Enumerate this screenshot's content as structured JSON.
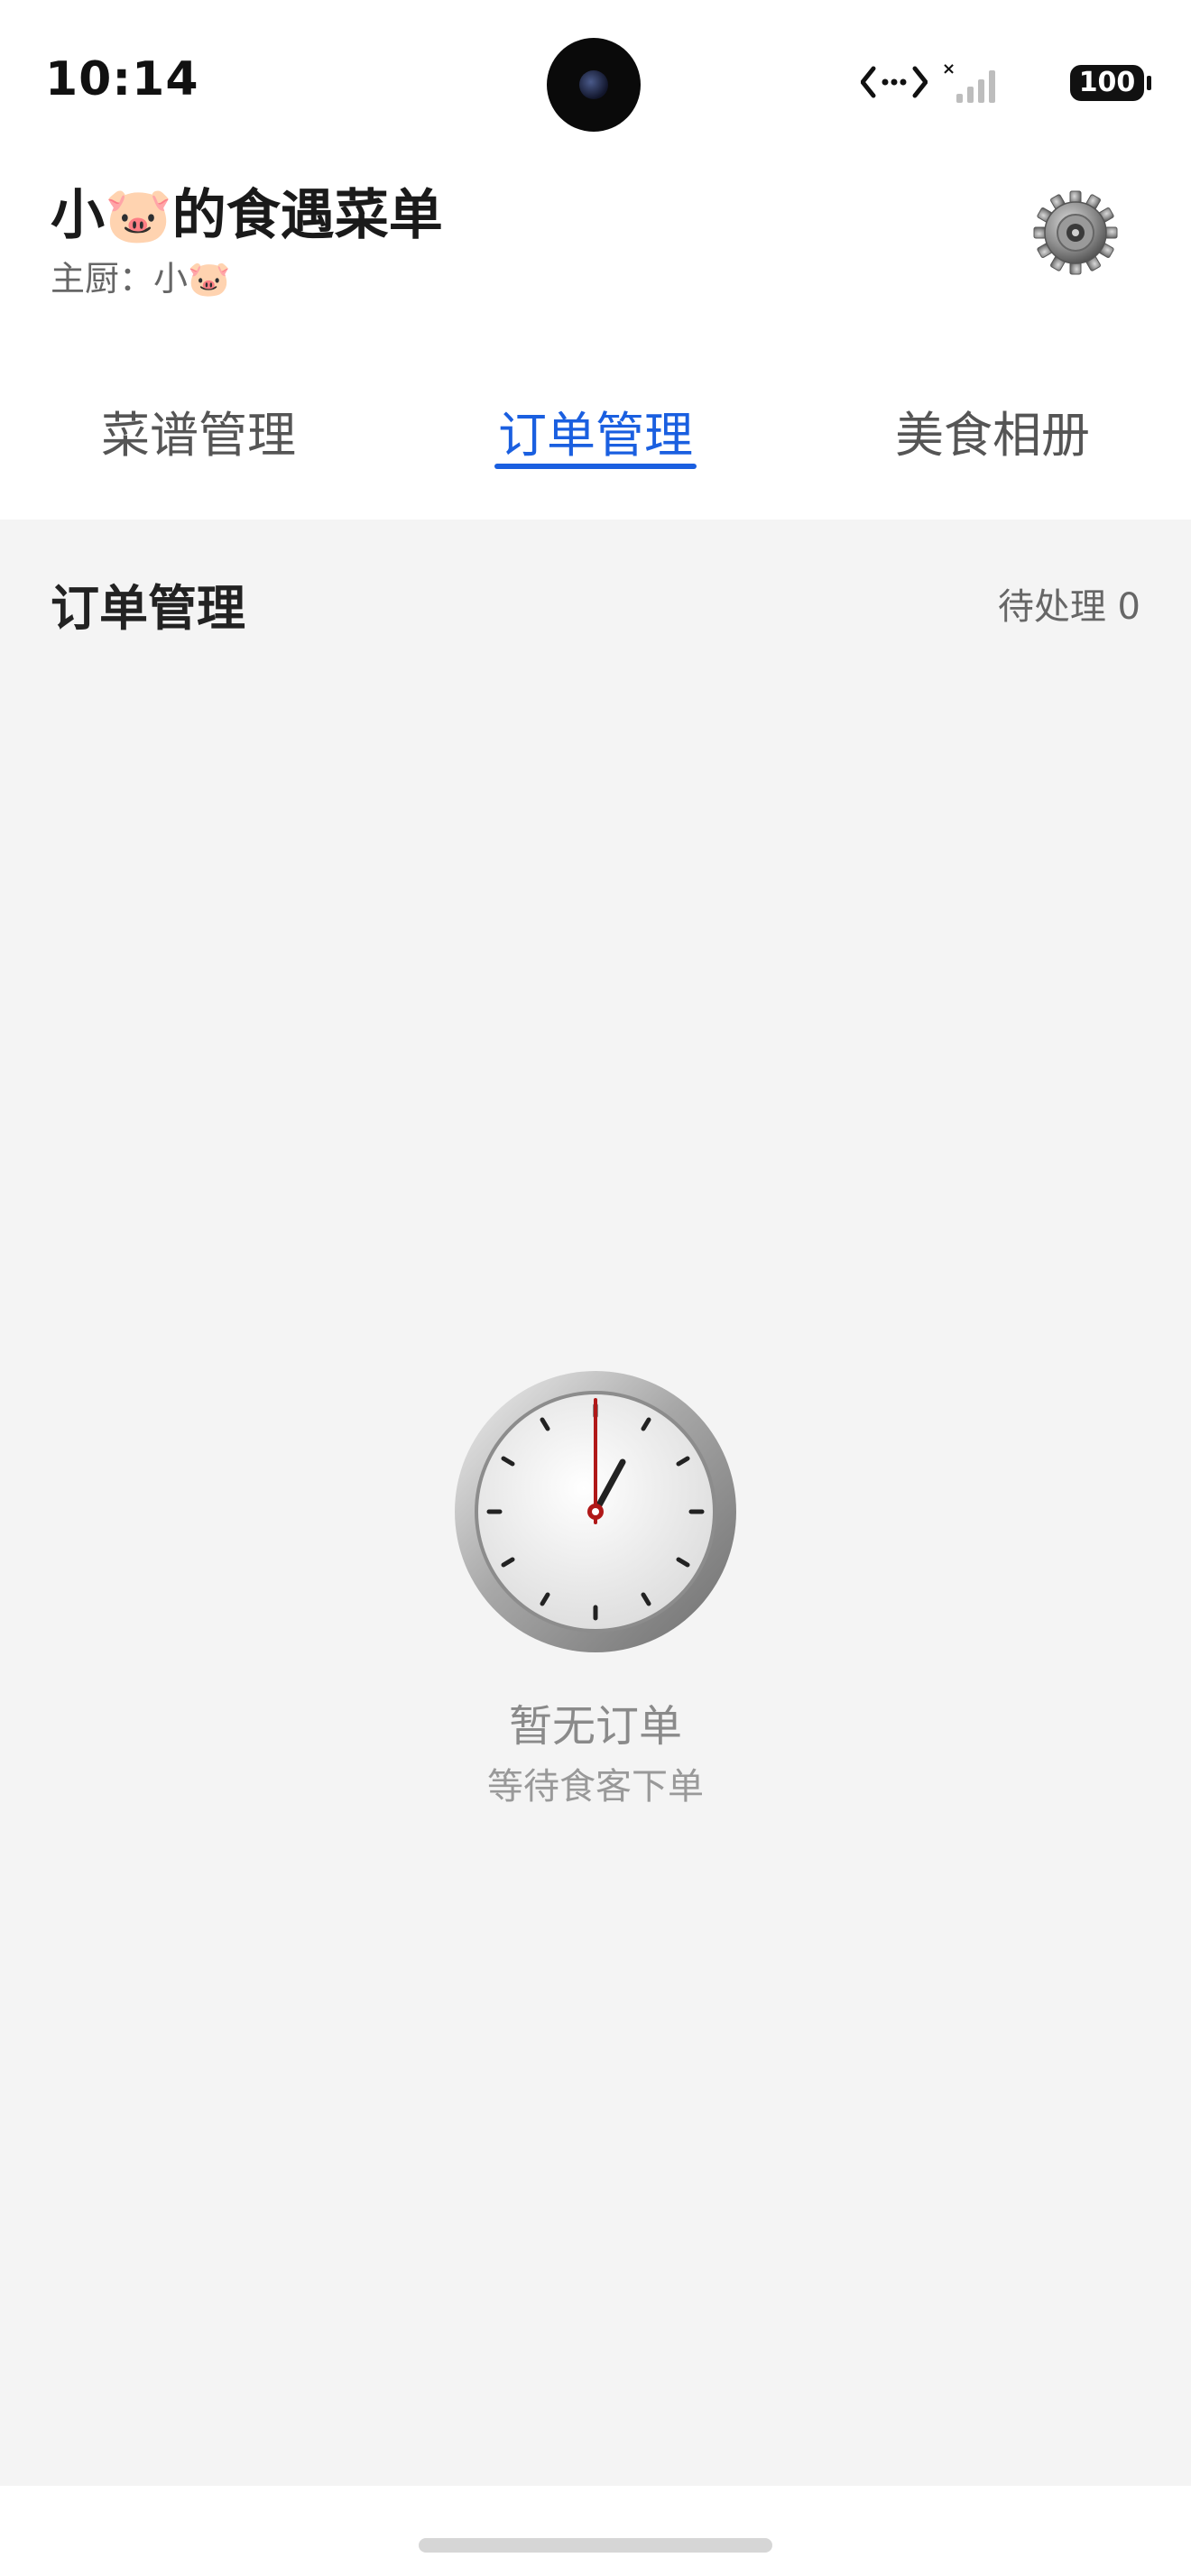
{
  "status_bar": {
    "time": "10:14",
    "battery": "100",
    "network_icon": "data-arrows-icon",
    "signal_icon": "signal-bars-icon"
  },
  "header": {
    "title": "小🐷的食遇菜单",
    "subtitle": "主厨：小🐷",
    "settings_icon": "gear-icon"
  },
  "tabs": [
    {
      "label": "菜谱管理",
      "active": false
    },
    {
      "label": "订单管理",
      "active": true
    },
    {
      "label": "美食相册",
      "active": false
    }
  ],
  "main": {
    "section_title": "订单管理",
    "pending_label": "待处理 0",
    "empty_state": {
      "icon": "clock-icon",
      "title": "暂无订单",
      "subtitle": "等待食客下单"
    }
  },
  "colors": {
    "accent": "#1a5fe0",
    "background": "#f4f4f4",
    "text_primary": "#1a1a1a",
    "text_secondary": "#666666"
  }
}
